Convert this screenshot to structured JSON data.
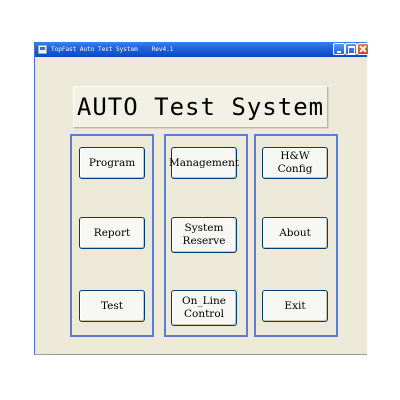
{
  "window": {
    "title": "TopFast Auto Test System",
    "version": "Rev4.1"
  },
  "heading": "AUTO Test System",
  "buttons": {
    "program": "Program",
    "management": "Management",
    "hw_config": "H&W Config",
    "report": "Report",
    "system_reserve_line1": "System",
    "system_reserve_line2": "Reserve",
    "about": "About",
    "test": "Test",
    "online_control_line1": "On_Line",
    "online_control_line2": "Control",
    "exit": "Exit"
  },
  "colors": {
    "titlebar": "#1f5fd8",
    "window_bg": "#ece9d8",
    "group_border": "#5b7ed0",
    "close_button": "#c8421c"
  }
}
